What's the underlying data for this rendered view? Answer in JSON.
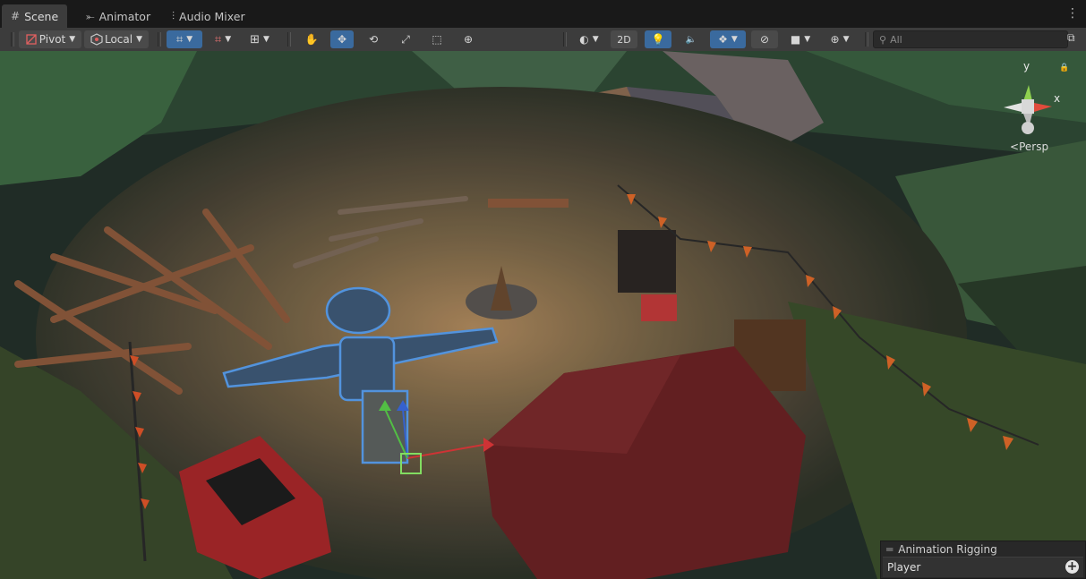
{
  "tabs": [
    {
      "label": "Scene",
      "icon": "grid-icon"
    },
    {
      "label": "Animator",
      "icon": "animator-icon"
    },
    {
      "label": "Audio Mixer",
      "icon": "audio-mixer-icon"
    }
  ],
  "toolbar": {
    "pivot_label": "Pivot",
    "local_label": "Local",
    "mode_2d_label": "2D",
    "search_placeholder": "All"
  },
  "gizmo": {
    "y_label": "y",
    "x_label": "x",
    "projection_label": "Persp"
  },
  "overlay": {
    "title": "Animation Rigging",
    "selected": "Player"
  },
  "colors": {
    "tab_bg": "#191919",
    "toolbar_bg": "#3c3c3c",
    "selected_tool": "#3a6a9e",
    "gizmo_y": "#8fd14f",
    "gizmo_x": "#e04b3c"
  }
}
